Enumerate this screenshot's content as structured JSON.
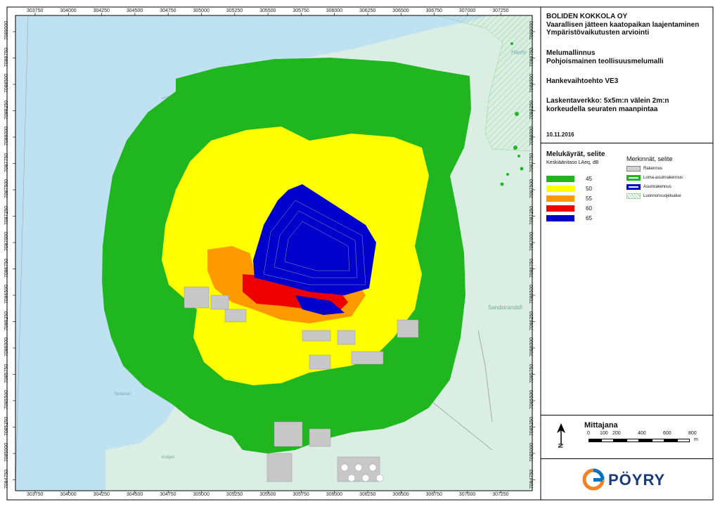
{
  "title": {
    "company": "BOLIDEN KOKKOLA OY",
    "line2": "Vaarallisen jätteen kaatopaikan laajentaminen",
    "line3": "Ympäristövaikutusten arviointi",
    "model1": "Melumallinnus",
    "model2": "Pohjoismainen teollisuusmelumalli",
    "alternative": "Hankevaihtoehto VE3",
    "grid1": "Laskentaverkko: 5x5m:n välein 2m:n",
    "grid2": "korkeudella seuraten maanpintaa",
    "date": "10.11.2016"
  },
  "noise_legend": {
    "title": "Melukäyrät, selite",
    "subtitle": "Keskiäänitaso LAeq, dB",
    "items": [
      {
        "label": "45",
        "color": "#1fb61f"
      },
      {
        "label": "50",
        "color": "#ffff00"
      },
      {
        "label": "55",
        "color": "#ff9900"
      },
      {
        "label": "60",
        "color": "#ee0000"
      },
      {
        "label": "65",
        "color": "#0000cc"
      }
    ]
  },
  "markings": {
    "title": "Merkinnät, selite",
    "items": [
      {
        "label": "Rakennus",
        "kind": "building"
      },
      {
        "label": "Loma-asuinrakennus",
        "kind": "holiday"
      },
      {
        "label": "Asuinrakennus",
        "kind": "residential"
      },
      {
        "label": "Luonnonsuojelualue",
        "kind": "nature"
      }
    ]
  },
  "scale": {
    "title": "Mittajana",
    "ticks": [
      "0",
      "100",
      "200",
      "400",
      "600",
      "800"
    ],
    "unit": "m"
  },
  "north_label": "N",
  "logo_text": "PÖYRY",
  "x_ticks": [
    "303750",
    "304000",
    "304250",
    "304500",
    "304750",
    "305000",
    "305250",
    "305500",
    "305750",
    "306000",
    "306250",
    "306500",
    "306750",
    "307000",
    "307250"
  ],
  "y_ticks": [
    "7089000",
    "7088750",
    "7088500",
    "7088250",
    "7088000",
    "7087750",
    "7087500",
    "7087250",
    "7087000",
    "7086750",
    "7086500",
    "7086250",
    "7086000",
    "7085750",
    "7085500",
    "7085250",
    "7085000",
    "7084750"
  ],
  "place_labels": {
    "hanhi": "Hanhi",
    "sandstrand": "Sandstrandsfi",
    "taulukari": "Taulukari",
    "kotijen": "Kotijen"
  },
  "colors": {
    "sea": "#bfe2f3",
    "land": "#daeee4",
    "frame": "#000000"
  }
}
